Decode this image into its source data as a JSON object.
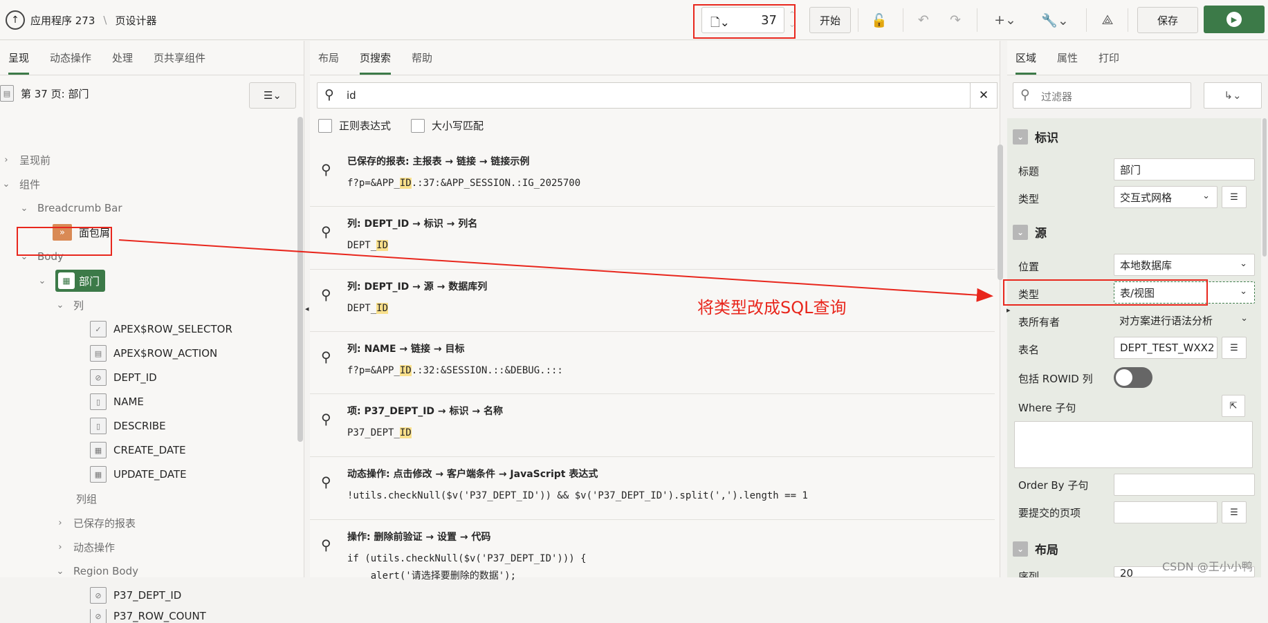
{
  "header": {
    "app": "应用程序 273",
    "separator": "\\",
    "page_designer": "页设计器",
    "page_number": "37",
    "start_button": "开始",
    "save_button": "保存"
  },
  "left": {
    "tabs": [
      "呈现",
      "动态操作",
      "处理",
      "页共享组件"
    ],
    "page_title": "第 37 页: 部门",
    "tree": {
      "before_render": "呈现前",
      "components": "组件",
      "breadcrumb_bar": "Breadcrumb Bar",
      "breadcrumb": "面包屑",
      "body": "Body",
      "region": "部门",
      "columns": "列",
      "col_items": [
        "APEX$ROW_SELECTOR",
        "APEX$ROW_ACTION",
        "DEPT_ID",
        "NAME",
        "DESCRIBE",
        "CREATE_DATE",
        "UPDATE_DATE"
      ],
      "column_groups": "列组",
      "saved_reports": "已保存的报表",
      "dynamic_actions": "动态操作",
      "region_body": "Region Body",
      "rb_items": [
        "P37_DEPT_ID",
        "P37_ROW_COUNT"
      ]
    }
  },
  "mid": {
    "tabs": [
      "布局",
      "页搜索",
      "帮助"
    ],
    "search_value": "id",
    "opt_regex": "正则表达式",
    "opt_case": "大小写匹配",
    "results": [
      {
        "title": "已保存的报表: 主报表 → 链接 → 链接示例",
        "pre": "f?p=&APP_",
        "hl": "ID",
        "post": ".:37:&APP_SESSION.:IG_2025700"
      },
      {
        "title": "列: DEPT_ID → 标识 → 列名",
        "pre": "DEPT_",
        "hl": "ID",
        "post": ""
      },
      {
        "title": "列: DEPT_ID → 源 → 数据库列",
        "pre": "DEPT_",
        "hl": "ID",
        "post": ""
      },
      {
        "title": "列: NAME → 链接 → 目标",
        "pre": "f?p=&APP_",
        "hl": "ID",
        "post": ".:32:&SESSION.::&DEBUG.:::"
      },
      {
        "title": "项: P37_DEPT_ID → 标识 → 名称",
        "pre": "P37_DEPT_",
        "hl": "ID",
        "post": ""
      },
      {
        "title": "动态操作: 点击修改 → 客户端条件 → JavaScript 表达式",
        "code": "!utils.checkNull($v('P37_DEPT_ID')) && $v('P37_DEPT_ID').split(',').length == 1"
      },
      {
        "title": "操作: 删除前验证 → 设置 → 代码",
        "code1": "if (utils.checkNull($v('P37_DEPT_ID'))) {",
        "code2": "    alert('请选择要删除的数据');"
      }
    ]
  },
  "right": {
    "tabs": [
      "区域",
      "属性",
      "打印"
    ],
    "filter_placeholder": "过滤器",
    "sec_identity": "标识",
    "lbl_title": "标题",
    "val_title": "部门",
    "lbl_type": "类型",
    "val_type": "交互式网格",
    "sec_source": "源",
    "lbl_location": "位置",
    "val_location": "本地数据库",
    "lbl_srctype": "类型",
    "val_srctype": "表/视图",
    "lbl_owner": "表所有者",
    "val_owner": "对方案进行语法分析",
    "lbl_table": "表名",
    "val_table": "DEPT_TEST_WXX2",
    "lbl_rowid": "包括 ROWID 列",
    "lbl_where": "Where 子句",
    "lbl_orderby": "Order By 子句",
    "lbl_submit": "要提交的页项",
    "sec_layout": "布局",
    "lbl_seq": "序列",
    "val_seq": "20"
  },
  "annotation": "将类型改成SQL查询",
  "watermark": "CSDN @王小小鸭"
}
